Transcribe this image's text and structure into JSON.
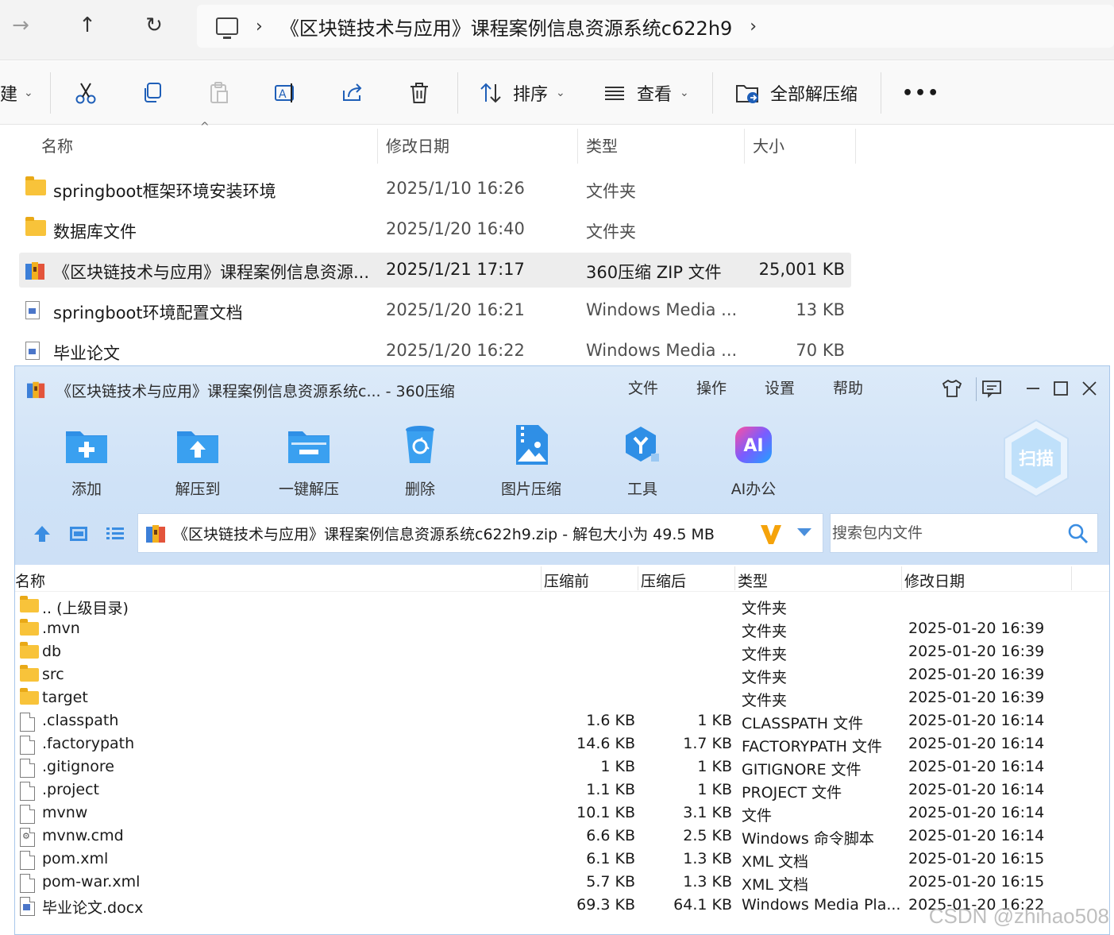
{
  "explorer": {
    "nav": {
      "back": "→",
      "up": "↑",
      "refresh": "↻"
    },
    "address": {
      "path": "《区块链技术与应用》课程案例信息资源系统c622h9"
    },
    "toolbar": {
      "new_label": "建",
      "sort_label": "排序",
      "view_label": "查看",
      "extract_all_label": "全部解压缩",
      "more_label": "•••"
    },
    "columns": {
      "name": "名称",
      "date": "修改日期",
      "type": "类型",
      "size": "大小"
    },
    "rows": [
      {
        "name": "springboot框架环境安装环境",
        "date": "2025/1/10 16:26",
        "type": "文件夹",
        "size": "",
        "icon": "folder"
      },
      {
        "name": "数据库文件",
        "date": "2025/1/20 16:40",
        "type": "文件夹",
        "size": "",
        "icon": "folder"
      },
      {
        "name": "《区块链技术与应用》课程案例信息资源...",
        "date": "2025/1/21 17:17",
        "type": "360压缩 ZIP 文件",
        "size": "25,001 KB",
        "icon": "zip"
      },
      {
        "name": "springboot环境配置文档",
        "date": "2025/1/20 16:21",
        "type": "Windows Media ...",
        "size": "13 KB",
        "icon": "doc"
      },
      {
        "name": "毕业论文",
        "date": "2025/1/20 16:22",
        "type": "Windows Media ...",
        "size": "70 KB",
        "icon": "doc"
      }
    ]
  },
  "zip": {
    "title": "《区块链技术与应用》课程案例信息资源系统c... - 360压缩",
    "menu": [
      "文件",
      "操作",
      "设置",
      "帮助"
    ],
    "tools": [
      {
        "label": "添加",
        "icon": "add-icon"
      },
      {
        "label": "解压到",
        "icon": "extract-to-icon"
      },
      {
        "label": "一键解压",
        "icon": "one-click-extract-icon"
      },
      {
        "label": "删除",
        "icon": "delete-icon"
      },
      {
        "label": "图片压缩",
        "icon": "image-compress-icon"
      },
      {
        "label": "工具",
        "icon": "tools-icon"
      },
      {
        "label": "AI办公",
        "icon": "ai-office-icon"
      }
    ],
    "scan_label": "扫描",
    "path_text": "《区块链技术与应用》课程案例信息资源系统c622h9.zip - 解包大小为 49.5 MB",
    "search_placeholder": "搜索包内文件",
    "columns": {
      "name": "名称",
      "before": "压缩前",
      "after": "压缩后",
      "type": "类型",
      "date": "修改日期"
    },
    "rows": [
      {
        "name": ".. (上级目录)",
        "before": "",
        "after": "",
        "type": "文件夹",
        "date": "",
        "icon": "folder"
      },
      {
        "name": ".mvn",
        "before": "",
        "after": "",
        "type": "文件夹",
        "date": "2025-01-20 16:39",
        "icon": "folder"
      },
      {
        "name": "db",
        "before": "",
        "after": "",
        "type": "文件夹",
        "date": "2025-01-20 16:39",
        "icon": "folder"
      },
      {
        "name": "src",
        "before": "",
        "after": "",
        "type": "文件夹",
        "date": "2025-01-20 16:39",
        "icon": "folder"
      },
      {
        "name": "target",
        "before": "",
        "after": "",
        "type": "文件夹",
        "date": "2025-01-20 16:39",
        "icon": "folder"
      },
      {
        "name": ".classpath",
        "before": "1.6 KB",
        "after": "1 KB",
        "type": "CLASSPATH 文件",
        "date": "2025-01-20 16:14",
        "icon": "file"
      },
      {
        "name": ".factorypath",
        "before": "14.6 KB",
        "after": "1.7 KB",
        "type": "FACTORYPATH 文件",
        "date": "2025-01-20 16:14",
        "icon": "file"
      },
      {
        "name": ".gitignore",
        "before": "1 KB",
        "after": "1 KB",
        "type": "GITIGNORE 文件",
        "date": "2025-01-20 16:14",
        "icon": "file"
      },
      {
        "name": ".project",
        "before": "1.1 KB",
        "after": "1 KB",
        "type": "PROJECT 文件",
        "date": "2025-01-20 16:14",
        "icon": "file"
      },
      {
        "name": "mvnw",
        "before": "10.1 KB",
        "after": "3.1 KB",
        "type": "文件",
        "date": "2025-01-20 16:14",
        "icon": "file"
      },
      {
        "name": "mvnw.cmd",
        "before": "6.6 KB",
        "after": "2.5 KB",
        "type": "Windows 命令脚本",
        "date": "2025-01-20 16:14",
        "icon": "cmd"
      },
      {
        "name": "pom.xml",
        "before": "6.1 KB",
        "after": "1.3 KB",
        "type": "XML 文档",
        "date": "2025-01-20 16:15",
        "icon": "file"
      },
      {
        "name": "pom-war.xml",
        "before": "5.7 KB",
        "after": "1.3 KB",
        "type": "XML 文档",
        "date": "2025-01-20 16:15",
        "icon": "file"
      },
      {
        "name": "毕业论文.docx",
        "before": "69.3 KB",
        "after": "64.1 KB",
        "type": "Windows Media Pla...",
        "date": "2025-01-20 16:22",
        "icon": "docx"
      }
    ]
  },
  "watermark": "CSDN @zhihao508"
}
